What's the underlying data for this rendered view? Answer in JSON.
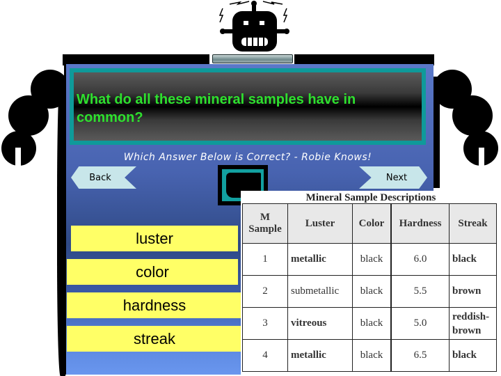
{
  "question": "What do all these mineral samples have in common?",
  "subtitle": "Which Answer Below is Correct? - Robie Knows!",
  "nav": {
    "back_label": "Back",
    "next_label": "Next"
  },
  "answers": [
    {
      "label": "luster"
    },
    {
      "label": "color"
    },
    {
      "label": "hardness"
    },
    {
      "label": "streak"
    }
  ],
  "table": {
    "title": "Mineral Sample Descriptions",
    "headers": [
      "M Sample",
      "Luster",
      "Color",
      "Hardness",
      "Streak"
    ],
    "rows": [
      [
        "1",
        "metallic",
        "black",
        "6.0",
        "black"
      ],
      [
        "2",
        "submetallic",
        "black",
        "5.5",
        "brown"
      ],
      [
        "3",
        "vitreous",
        "black",
        "5.0",
        "reddish-brown"
      ],
      [
        "4",
        "metallic",
        "black",
        "6.5",
        "black"
      ]
    ]
  },
  "colors": {
    "question_text": "#2ee02e",
    "answer_bg": "#ffff66",
    "frame_teal": "#0f9a9a",
    "panel_blue": "#4863b0"
  }
}
